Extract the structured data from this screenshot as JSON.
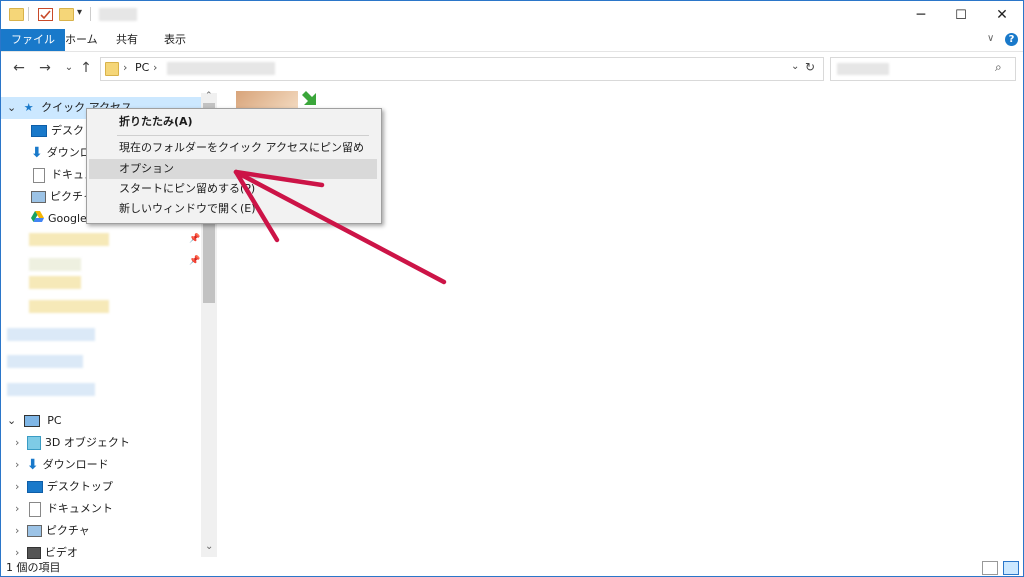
{
  "window": {
    "controls": {
      "minimize": "─",
      "maximize": "☐",
      "close": "✕"
    }
  },
  "ribbon": {
    "tabs": [
      "ファイル",
      "ホーム",
      "共有",
      "表示"
    ],
    "help": "?"
  },
  "address": {
    "path": [
      "PC"
    ],
    "separator": "›"
  },
  "nav": {
    "quick_access": "クイック アクセス",
    "quick_items": [
      {
        "label": "デスクトップ",
        "icon": "desktop-icon"
      },
      {
        "label": "ダウンロード",
        "icon": "download-icon"
      },
      {
        "label": "ドキュメント",
        "icon": "document-icon"
      },
      {
        "label": "ピクチャ",
        "icon": "picture-icon"
      },
      {
        "label": "Google",
        "icon": "google-drive-icon"
      }
    ],
    "pc": "PC",
    "pc_items": [
      {
        "label": "3D オブジェクト",
        "icon": "3d-object-icon"
      },
      {
        "label": "ダウンロード",
        "icon": "download-icon"
      },
      {
        "label": "デスクトップ",
        "icon": "desktop-icon"
      },
      {
        "label": "ドキュメント",
        "icon": "document-icon"
      },
      {
        "label": "ピクチャ",
        "icon": "picture-icon"
      },
      {
        "label": "ビデオ",
        "icon": "video-icon"
      }
    ]
  },
  "context_menu": {
    "items": [
      {
        "label": "折りたたみ(A)",
        "bold": true
      },
      {
        "label": "現在のフォルダーをクイック アクセスにピン留め"
      },
      {
        "label": "オプション",
        "highlighted": true
      },
      {
        "label": "スタートにピン留めする(P)"
      },
      {
        "label": "新しいウィンドウで開く(E)"
      }
    ]
  },
  "status": {
    "item_count": "1 個の項目"
  },
  "colors": {
    "accent": "#1979ca",
    "arrow": "#cc1447",
    "selection": "#cce8ff"
  }
}
